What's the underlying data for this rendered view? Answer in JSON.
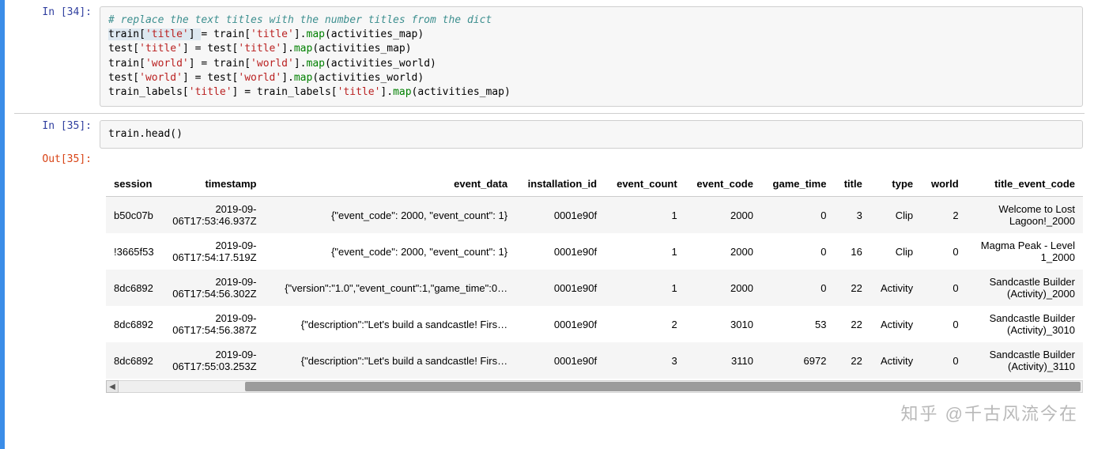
{
  "cells": {
    "c34": {
      "prompt": "In [34]:",
      "comment": "# replace the text titles with the number titles from the dict",
      "lines": {
        "l1_a": "train[",
        "l1_b": "'title'",
        "l1_c": "] ",
        "l1_eq": "=",
        "l1_d": " train[",
        "l1_e": "'title'",
        "l1_f": "].",
        "l1_g": "map",
        "l1_h": "(activities_map)",
        "l2_a": "test[",
        "l2_b": "'title'",
        "l2_c": "] ",
        "l2_eq": "=",
        "l2_d": " test[",
        "l2_e": "'title'",
        "l2_f": "].",
        "l2_g": "map",
        "l2_h": "(activities_map)",
        "l3_a": "train[",
        "l3_b": "'world'",
        "l3_c": "] ",
        "l3_eq": "=",
        "l3_d": " train[",
        "l3_e": "'world'",
        "l3_f": "].",
        "l3_g": "map",
        "l3_h": "(activities_world)",
        "l4_a": "test[",
        "l4_b": "'world'",
        "l4_c": "] ",
        "l4_eq": "=",
        "l4_d": " test[",
        "l4_e": "'world'",
        "l4_f": "].",
        "l4_g": "map",
        "l4_h": "(activities_world)",
        "l5_a": "train_labels[",
        "l5_b": "'title'",
        "l5_c": "] ",
        "l5_eq": "=",
        "l5_d": " train_labels[",
        "l5_e": "'title'",
        "l5_f": "].",
        "l5_g": "map",
        "l5_h": "(activities_map)"
      }
    },
    "c35": {
      "prompt": "In [35]:",
      "code_a": "train.",
      "code_b": "head",
      "code_c": "()"
    },
    "out35": {
      "prompt": "Out[35]:",
      "columns": [
        "session",
        "timestamp",
        "event_data",
        "installation_id",
        "event_count",
        "event_code",
        "game_time",
        "title",
        "type",
        "world",
        "title_event_code"
      ],
      "rows": [
        {
          "session": "b50c07b",
          "timestamp": "2019-09-06T17:53:46.937Z",
          "event_data": "{\"event_code\": 2000, \"event_count\": 1}",
          "installation_id": "0001e90f",
          "event_count": "1",
          "event_code": "2000",
          "game_time": "0",
          "title": "3",
          "type": "Clip",
          "world": "2",
          "title_event_code": "Welcome to Lost Lagoon!_2000"
        },
        {
          "session": "!3665f53",
          "timestamp": "2019-09-06T17:54:17.519Z",
          "event_data": "{\"event_code\": 2000, \"event_count\": 1}",
          "installation_id": "0001e90f",
          "event_count": "1",
          "event_code": "2000",
          "game_time": "0",
          "title": "16",
          "type": "Clip",
          "world": "0",
          "title_event_code": "Magma Peak - Level 1_2000"
        },
        {
          "session": "8dc6892",
          "timestamp": "2019-09-06T17:54:56.302Z",
          "event_data": "{\"version\":\"1.0\",\"event_count\":1,\"game_time\":0…",
          "installation_id": "0001e90f",
          "event_count": "1",
          "event_code": "2000",
          "game_time": "0",
          "title": "22",
          "type": "Activity",
          "world": "0",
          "title_event_code": "Sandcastle Builder (Activity)_2000"
        },
        {
          "session": "8dc6892",
          "timestamp": "2019-09-06T17:54:56.387Z",
          "event_data": "{\"description\":\"Let's build a sandcastle! Firs…",
          "installation_id": "0001e90f",
          "event_count": "2",
          "event_code": "3010",
          "game_time": "53",
          "title": "22",
          "type": "Activity",
          "world": "0",
          "title_event_code": "Sandcastle Builder (Activity)_3010"
        },
        {
          "session": "8dc6892",
          "timestamp": "2019-09-06T17:55:03.253Z",
          "event_data": "{\"description\":\"Let's build a sandcastle! Firs…",
          "installation_id": "0001e90f",
          "event_count": "3",
          "event_code": "3110",
          "game_time": "6972",
          "title": "22",
          "type": "Activity",
          "world": "0",
          "title_event_code": "Sandcastle Builder (Activity)_3110"
        }
      ]
    }
  },
  "watermark": "知乎 @千古风流今在"
}
